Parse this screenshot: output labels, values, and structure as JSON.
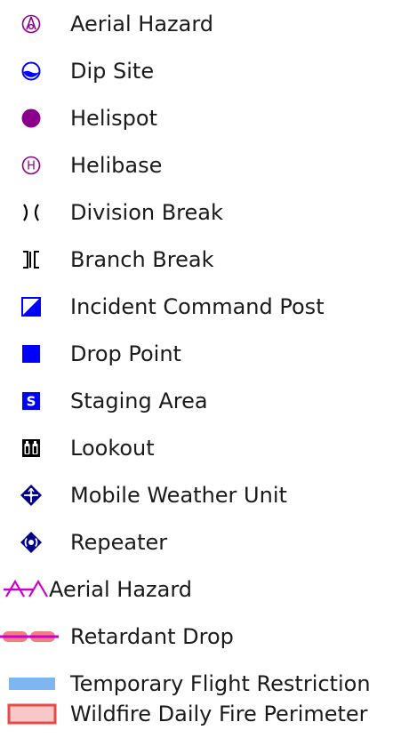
{
  "legend": {
    "items": [
      {
        "label": "Aerial Hazard",
        "icon": "aerial-hazard-point-icon"
      },
      {
        "label": "Dip Site",
        "icon": "dip-site-icon"
      },
      {
        "label": "Helispot",
        "icon": "helispot-icon"
      },
      {
        "label": "Helibase",
        "icon": "helibase-icon"
      },
      {
        "label": "Division Break",
        "icon": "division-break-icon"
      },
      {
        "label": "Branch Break",
        "icon": "branch-break-icon"
      },
      {
        "label": "Incident Command Post",
        "icon": "incident-command-post-icon"
      },
      {
        "label": "Drop Point",
        "icon": "drop-point-icon"
      },
      {
        "label": "Staging Area",
        "icon": "staging-area-icon"
      },
      {
        "label": "Lookout",
        "icon": "lookout-icon"
      },
      {
        "label": "Mobile Weather Unit",
        "icon": "mobile-weather-unit-icon"
      },
      {
        "label": "Repeater",
        "icon": "repeater-icon"
      },
      {
        "label": "Aerial Hazard",
        "icon": "aerial-hazard-line-icon"
      },
      {
        "label": "Retardant Drop",
        "icon": "retardant-drop-icon"
      },
      {
        "label": "Temporary Flight Restriction",
        "icon": "temporary-flight-restriction-icon"
      },
      {
        "label": "Wildfire Daily Fire Perimeter",
        "icon": "wildfire-daily-fire-perimeter-icon"
      }
    ],
    "staging_letter": "S",
    "helibase_letter": "H"
  },
  "colors": {
    "purple": "#8b008b",
    "magenta": "#cc00cc",
    "blue": "#0000ff",
    "navy": "#00008b",
    "tfr": "#7eb6f2",
    "perimeter_fill": "#f8c8c8",
    "perimeter_stroke": "#e84a4a",
    "retardant": "#f08080",
    "text": "#1a1a1a"
  }
}
